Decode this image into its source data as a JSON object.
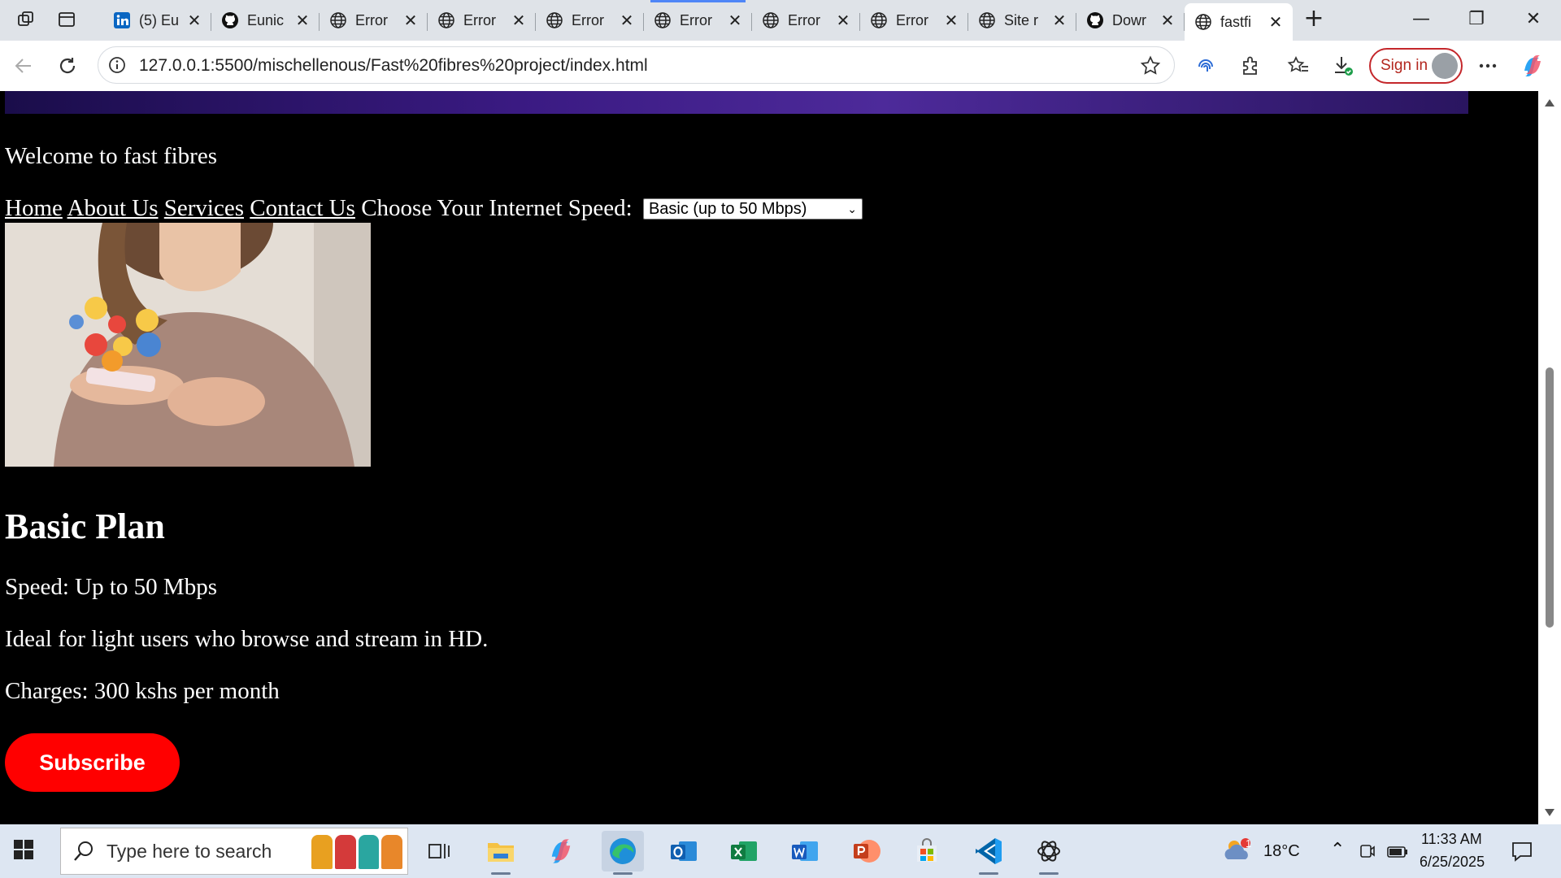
{
  "browser": {
    "tabs": [
      {
        "title": "(5) Eu",
        "favicon": "linkedin-icon"
      },
      {
        "title": "Eunic",
        "favicon": "github-icon"
      },
      {
        "title": "Error",
        "favicon": "globe-icon"
      },
      {
        "title": "Error",
        "favicon": "globe-icon"
      },
      {
        "title": "Error",
        "favicon": "globe-icon"
      },
      {
        "title": "Error",
        "favicon": "globe-icon"
      },
      {
        "title": "Error",
        "favicon": "globe-icon"
      },
      {
        "title": "Error",
        "favicon": "globe-icon"
      },
      {
        "title": "Site r",
        "favicon": "globe-icon"
      },
      {
        "title": "Dowr",
        "favicon": "github-icon"
      },
      {
        "title": "fastfi",
        "favicon": "globe-icon",
        "active": true
      }
    ],
    "address": "127.0.0.1:5500/mischellenous/Fast%20fibres%20project/index.html",
    "signin_label": "Sign in"
  },
  "page": {
    "welcome": "Welcome to fast fibres",
    "nav": {
      "home": "Home",
      "about": "About Us",
      "services": "Services",
      "contact": "Contact Us",
      "speed_label": "Choose Your Internet Speed:",
      "speed_selected": "Basic (up to 50 Mbps)"
    },
    "plan": {
      "title": "Basic Plan",
      "speed": "Speed: Up to 50 Mbps",
      "description": "Ideal for light users who browse and stream in HD.",
      "charges": "Charges: 300 kshs per month",
      "subscribe": "Subscribe"
    }
  },
  "taskbar": {
    "search_placeholder": "Type here to search",
    "weather_temp": "18°C",
    "weather_badge": "1",
    "time": "11:33 AM",
    "date": "6/25/2025"
  },
  "colors": {
    "accent_red": "#ff0000",
    "banner_purple": "#3a1a82",
    "page_bg": "#000000"
  }
}
